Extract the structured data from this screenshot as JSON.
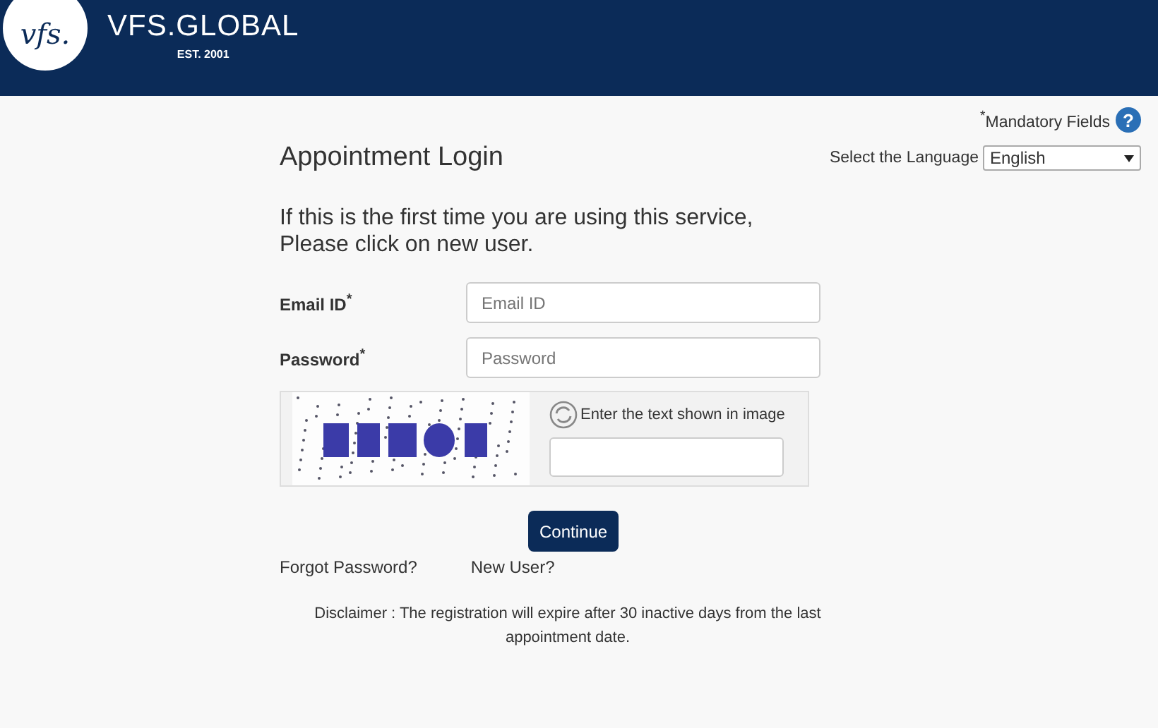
{
  "header": {
    "logo_mark": "vfs.",
    "brand": "VFS.GLOBAL",
    "tagline": "EST. 2001"
  },
  "mandatory_note": "$^{*}$Mandatory Fields",
  "help_icon": "?",
  "title": "Appointment Login",
  "language": {
    "label": "Select the Language",
    "value": "English"
  },
  "intro": [
    "If this is the first time you are using this service,",
    "Please click on new user."
  ],
  "fields": [
    {
      "label": "Email ID$^{*}$",
      "placeholder": "Email ID"
    },
    {
      "label": "Password$^{*}$",
      "placeholder": "Password"
    }
  ],
  "captcha": {
    "kind": "picture",
    "prompt": "Enter the text shown in image"
  },
  "continue_button": "Continue",
  "links": [
    "Forgot Password?",
    "New User?"
  ],
  "disclaimer": "Disclaimer : The registration will expire after 30 inactive days from the last appointment date."
}
